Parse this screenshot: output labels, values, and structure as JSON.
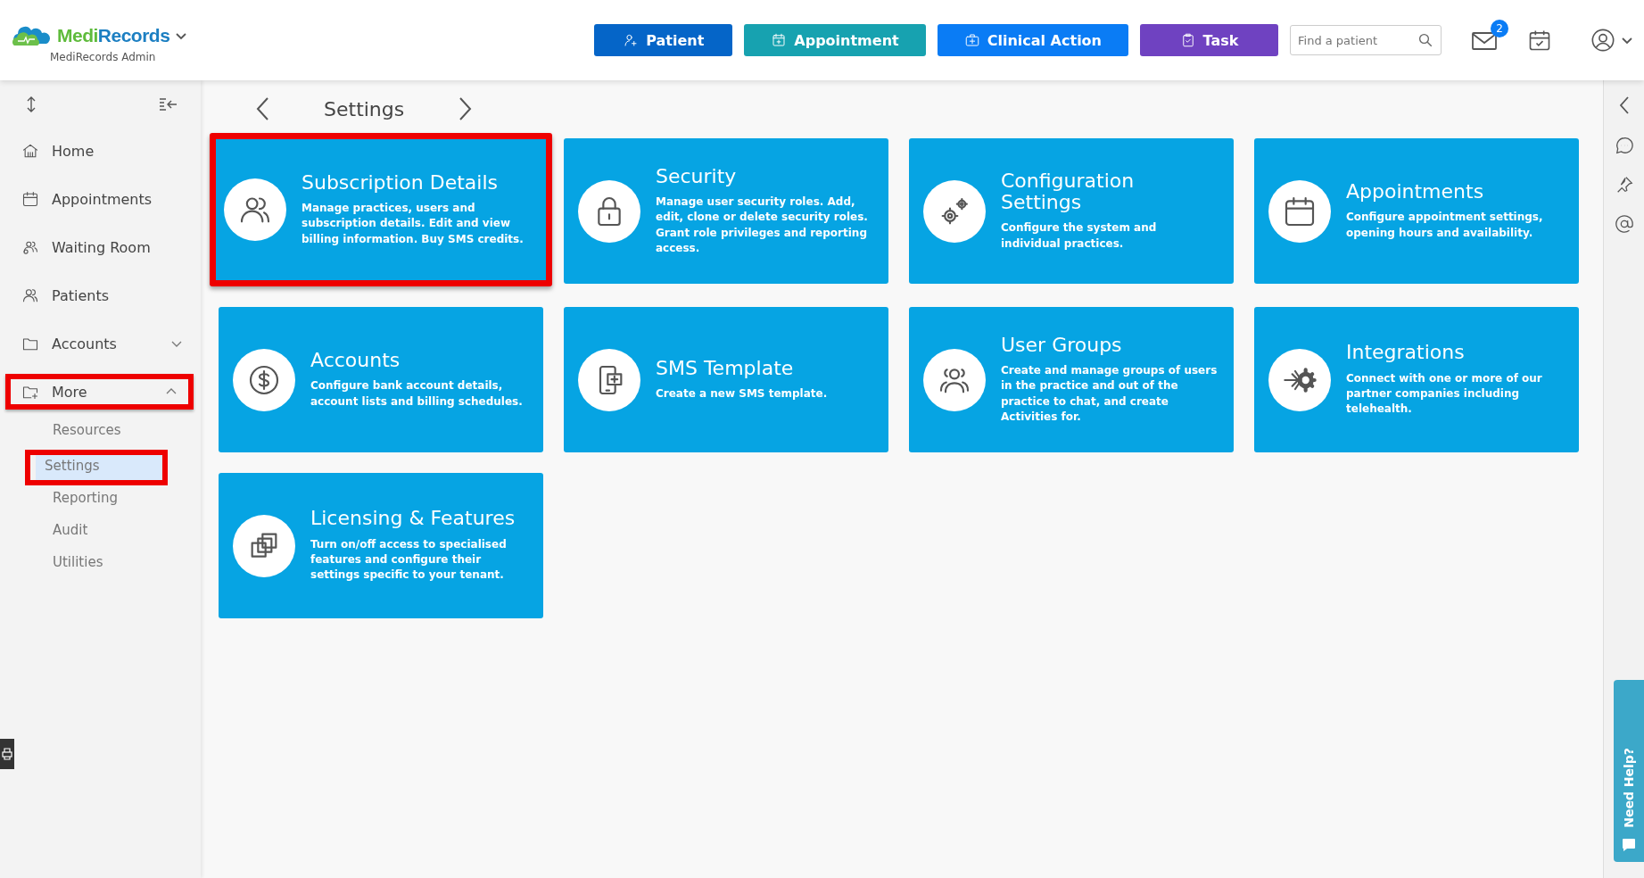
{
  "brand": {
    "name_part1": "Medi",
    "name_part2": "Records",
    "subtitle": "MediRecords Admin"
  },
  "quick_actions": [
    {
      "label": "Patient",
      "kind": "patient",
      "color": "#0565c8"
    },
    {
      "label": "Appointment",
      "kind": "appointment",
      "color": "#17a2b0"
    },
    {
      "label": "Clinical Action",
      "kind": "clinical",
      "color": "#0a7cf5"
    },
    {
      "label": "Task",
      "kind": "task",
      "color": "#6f42c1"
    }
  ],
  "search": {
    "placeholder": "Find a patient"
  },
  "notifications": {
    "count": "2"
  },
  "sidebar": {
    "items": [
      {
        "label": "Home",
        "highlighted": false
      },
      {
        "label": "Appointments",
        "highlighted": false
      },
      {
        "label": "Waiting Room",
        "highlighted": false
      },
      {
        "label": "Patients",
        "highlighted": false
      },
      {
        "label": "Accounts",
        "expanded": false,
        "highlighted": false
      },
      {
        "label": "More",
        "expanded": true,
        "highlighted": true,
        "children": [
          {
            "label": "Resources",
            "selected": false,
            "highlighted": false
          },
          {
            "label": "Settings",
            "selected": true,
            "highlighted": true
          },
          {
            "label": "Reporting",
            "selected": false,
            "highlighted": false
          },
          {
            "label": "Audit",
            "selected": false,
            "highlighted": false
          },
          {
            "label": "Utilities",
            "selected": false,
            "highlighted": false
          }
        ]
      }
    ]
  },
  "page": {
    "title": "Settings"
  },
  "cards": [
    {
      "title": "Subscription Details",
      "description": "Manage practices, users and subscription details. Edit and view billing information. Buy SMS credits.",
      "highlighted": true
    },
    {
      "title": "Security",
      "description": "Manage user security roles. Add, edit, clone or delete security roles. Grant role privileges and reporting access.",
      "highlighted": false
    },
    {
      "title": "Configuration Settings",
      "description": "Configure the system and individual practices.",
      "highlighted": false
    },
    {
      "title": "Appointments",
      "description": "Configure appointment settings, opening hours and availability.",
      "highlighted": false
    },
    {
      "title": "Accounts",
      "description": "Configure bank account details, account lists and billing schedules.",
      "highlighted": false
    },
    {
      "title": "SMS Template",
      "description": "Create a new SMS template.",
      "highlighted": false
    },
    {
      "title": "User Groups",
      "description": "Create and manage groups of users in the practice and out of the practice to chat, and create Activities for.",
      "highlighted": false
    },
    {
      "title": "Integrations",
      "description": "Connect with one or more of our partner companies including telehealth.",
      "highlighted": false
    },
    {
      "title": "Licensing & Features",
      "description": "Turn on/off access to specialised features and configure their settings specific to your tenant.",
      "highlighted": false
    }
  ],
  "help_tab": {
    "label": "Need Help?"
  }
}
